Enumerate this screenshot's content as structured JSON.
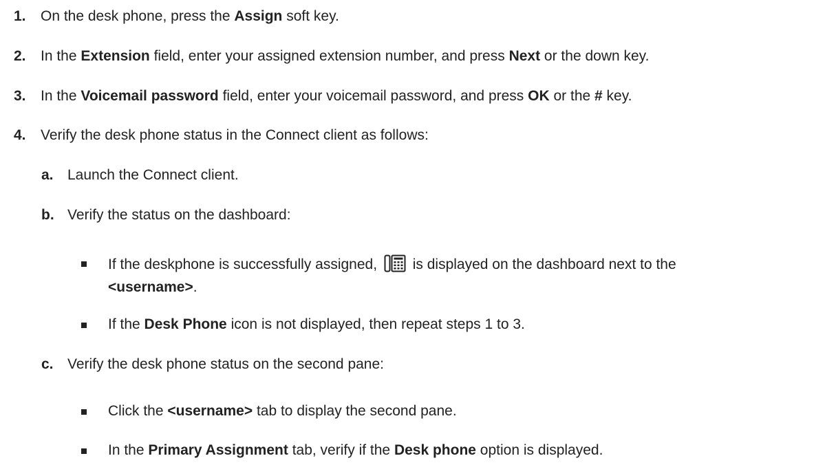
{
  "steps": [
    {
      "num": "1.",
      "parts": [
        "On the desk phone, press the ",
        "Assign",
        " soft key."
      ]
    },
    {
      "num": "2.",
      "parts": [
        "In the ",
        "Extension",
        " field, enter your assigned extension number, and press ",
        "Next",
        " or the down key."
      ]
    },
    {
      "num": "3.",
      "parts": [
        "In the ",
        "Voicemail password",
        " field, enter your voicemail password, and press ",
        "OK",
        " or the ",
        "#",
        " key."
      ]
    },
    {
      "num": "4.",
      "parts": [
        "Verify the desk phone status in the Connect client as follows:"
      ]
    }
  ],
  "substeps": [
    {
      "num": "a.",
      "text": "Launch the Connect client."
    },
    {
      "num": "b.",
      "text": "Verify the status on the dashboard:"
    },
    {
      "num": "c.",
      "text": "Verify the desk phone status on the second pane:"
    }
  ],
  "bullets_b": [
    {
      "line1_pre": "If the deskphone is successfully assigned, ",
      "line1_post": " is displayed on the dashboard next to the",
      "line2_bold": "<username>",
      "line2_post": "."
    },
    {
      "pre": "If the ",
      "bold": "Desk Phone",
      "post": " icon is not displayed, then repeat steps 1 to 3."
    }
  ],
  "bullets_c": [
    {
      "pre": "Click the ",
      "bold": "<username>",
      "post": " tab to display the second pane."
    },
    {
      "pre": "In the ",
      "bold1": "Primary Assignment",
      "mid": " tab, verify if the ",
      "bold2": "Desk phone",
      "post": " option is displayed."
    }
  ],
  "icons": {
    "desk_phone": "desk-phone-icon"
  }
}
